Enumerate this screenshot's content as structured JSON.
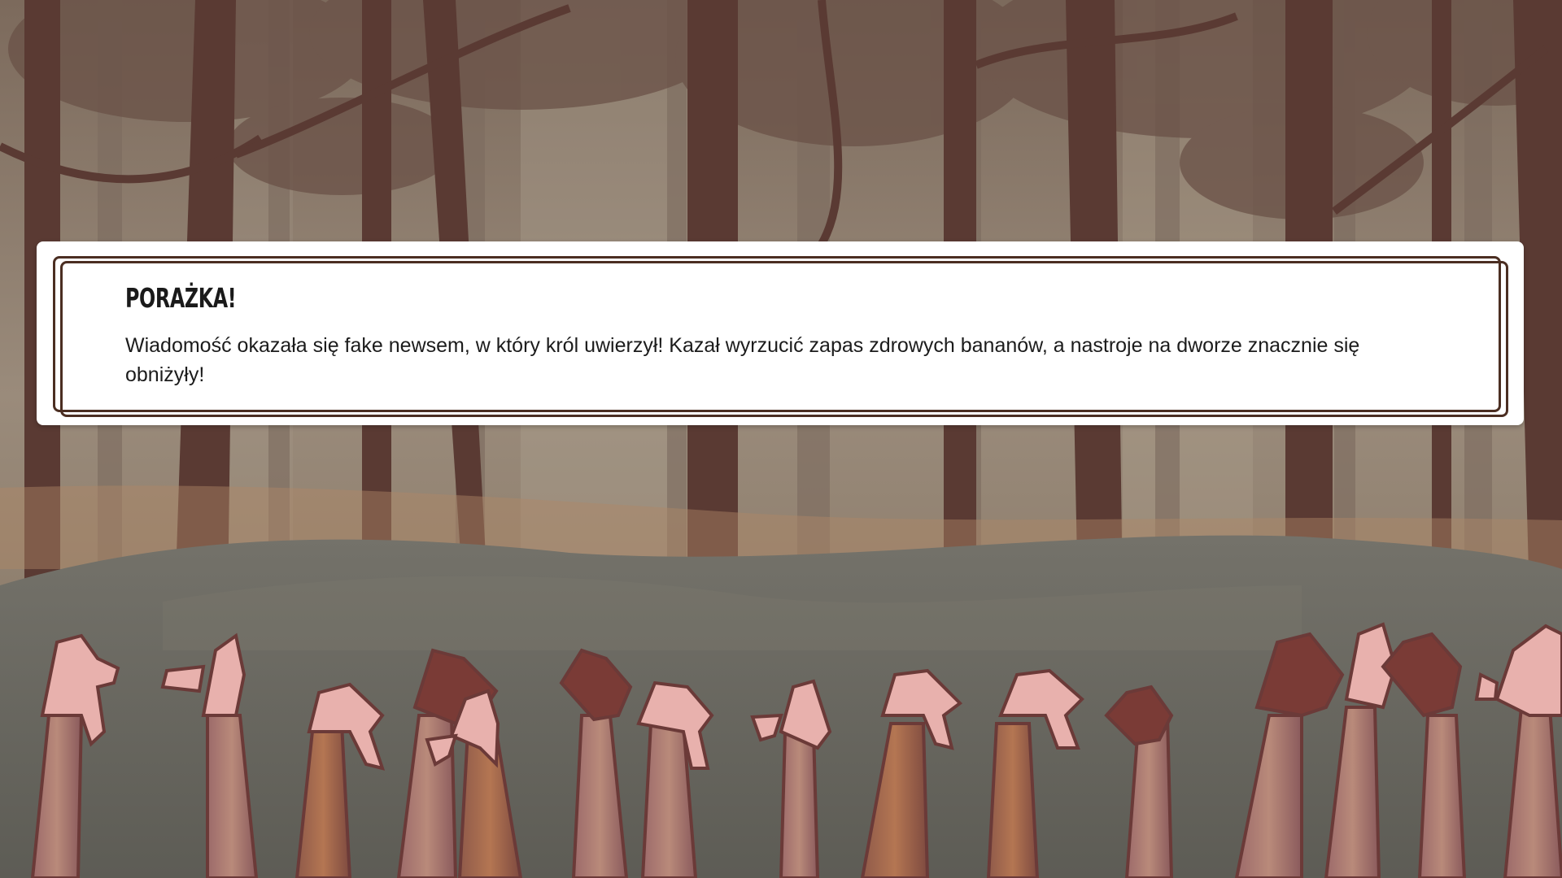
{
  "dialog": {
    "title": "PORAŻKA!",
    "message": "Wiadomość okazała się fake newsem, w który król uwierzył! Kazał wyrzucić zapas zdrowych bananów, a nastroje na dworze znacznie się obniżyły!"
  },
  "scene": {
    "background": "forest",
    "icons": [
      "forest-background-image",
      "audience-creatures-image"
    ]
  },
  "colors": {
    "frame": "#4b2e22",
    "dialog_bg": "#ffffff",
    "text": "#1c1c1c",
    "sky": "#8b7f71",
    "trunk": "#5a3a33",
    "ground": "#6b6b60",
    "creature_light": "#e8b1ad",
    "creature_dark": "#7a3b36"
  }
}
